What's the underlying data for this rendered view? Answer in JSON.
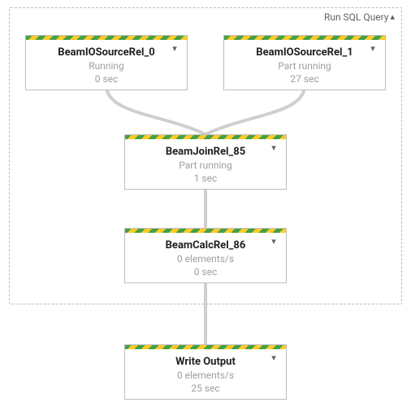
{
  "colors": {
    "stripe_yellow": "#ffca28",
    "stripe_green": "#43a047",
    "connector": "#cfcfcf",
    "dashed_border": "#bdbdbd",
    "text_primary": "#212121",
    "text_secondary": "#9e9e9e"
  },
  "group": {
    "label": "Run SQL Query",
    "collapse_icon": "chevron-up"
  },
  "nodes": {
    "source0": {
      "title": "BeamIOSourceRel_0",
      "status": "Running",
      "meta": "0 sec",
      "expand_icon": "chevron-down"
    },
    "source1": {
      "title": "BeamIOSourceRel_1",
      "status": "Part running",
      "meta": "27 sec",
      "expand_icon": "chevron-down"
    },
    "join": {
      "title": "BeamJoinRel_85",
      "status": "Part running",
      "meta": "1 sec",
      "expand_icon": "chevron-down"
    },
    "calc": {
      "title": "BeamCalcRel_86",
      "status": "0 elements/s",
      "meta": "0 sec",
      "expand_icon": "chevron-down"
    },
    "write": {
      "title": "Write Output",
      "status": "0 elements/s",
      "meta": "25 sec",
      "expand_icon": "chevron-down"
    }
  }
}
